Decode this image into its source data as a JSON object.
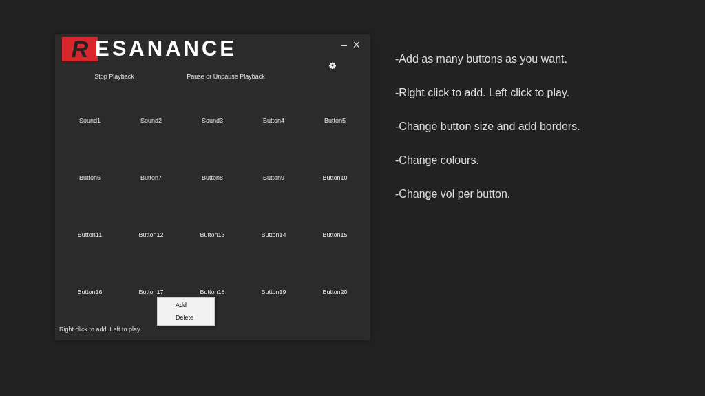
{
  "window": {
    "logo": {
      "initial": "R",
      "rest": "ESANANCE"
    },
    "controls": {
      "minimize": "–",
      "close": "✕"
    }
  },
  "playback_buttons": [
    "Stop Playback",
    "Pause or Unpause Playback"
  ],
  "sound_buttons": [
    "Sound1",
    "Sound2",
    "Sound3",
    "Button4",
    "Button5",
    "Button6",
    "Button7",
    "Button8",
    "Button9",
    "Button10",
    "Button11",
    "Button12",
    "Button13",
    "Button14",
    "Button15",
    "Button16",
    "Button17",
    "Button18",
    "Button19",
    "Button20"
  ],
  "context_menu": [
    "Add",
    "Delete"
  ],
  "status_text": "Right click to add. Left to play.",
  "notes": [
    "-Add as many buttons as you want.",
    "-Right click to add. Left click to play.",
    "-Change button size and add borders.",
    "-Change colours.",
    "-Change vol per button."
  ]
}
